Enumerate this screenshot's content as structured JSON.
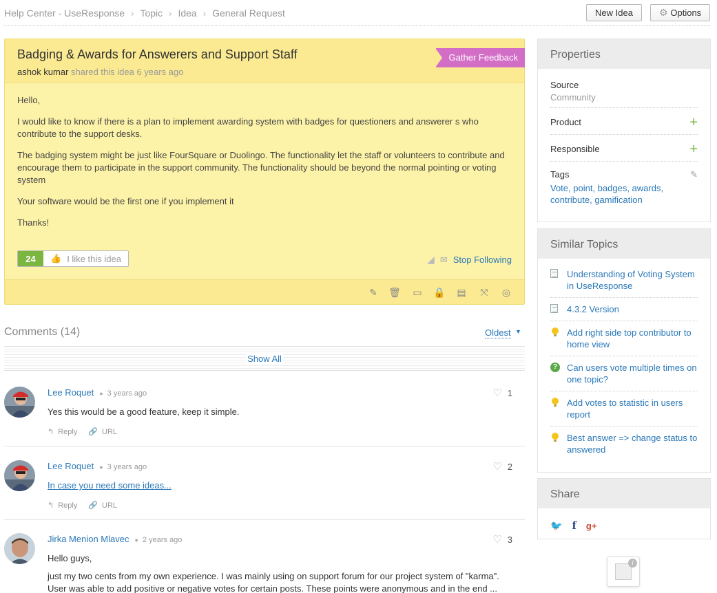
{
  "breadcrumbs": [
    "Help Center - UseResponse",
    "Topic",
    "Idea",
    "General Request"
  ],
  "toolbar": {
    "new_idea": "New Idea",
    "options": "Options"
  },
  "idea": {
    "title": "Badging & Awards for Answerers and Support Staff",
    "author": "ashok kumar",
    "meta": "shared this idea 6 years ago",
    "status": "Gather Feedback",
    "body": [
      "Hello,",
      "I would like to know if there is a plan to implement awarding system with badges for questioners and answerer s who contribute to the support desks.",
      "The badging system might be just like FourSquare or Duolingo. The functionality let the staff or volunteers to contribute and encourage them to participate in the support community. The functionality should be beyond the normal pointing or voting system",
      "Your software would be the first one if you implement it",
      "Thanks!"
    ],
    "vote_count": "24",
    "like_label": "I like this idea",
    "follow_label": "Stop Following",
    "tools": [
      "edit-icon",
      "delete-icon",
      "move-icon",
      "lock-icon",
      "card-icon",
      "merge-icon",
      "support-icon"
    ]
  },
  "comments": {
    "title": "Comments (14)",
    "sort": "Oldest",
    "show_all": "Show All",
    "reply_label": "Reply",
    "url_label": "URL",
    "items": [
      {
        "author": "Lee Roquet",
        "time": "3 years ago",
        "text": "Yes this would be a good feature, keep it simple.",
        "likes": "1"
      },
      {
        "author": "Lee Roquet",
        "time": "3 years ago",
        "text": "In case you need some ideas...",
        "likes": "2"
      },
      {
        "author": "Jirka Menion Mlavec",
        "time": "2 years ago",
        "text": "Hello guys,",
        "text2": "just my two cents from my own experience. I was mainly using on support forum for our project system of \"karma\". User was able to add positive or negative votes for certain posts. These points were anonymous and in the end ... after two",
        "likes": "3"
      }
    ]
  },
  "properties": {
    "title": "Properties",
    "source_label": "Source",
    "source_value": "Community",
    "product_label": "Product",
    "responsible_label": "Responsible",
    "tags_label": "Tags",
    "tags_line1": "Vote, point, badges, awards,",
    "tags_line2": "contribute, gamification"
  },
  "similar": {
    "title": "Similar Topics",
    "items": [
      {
        "icon": "document-icon",
        "line1": "Understanding of Voting System",
        "line2": "in UseResponse"
      },
      {
        "icon": "document-icon",
        "line1": "4.3.2 Version",
        "line2": ""
      },
      {
        "icon": "idea-bulb-icon",
        "line1": "Add right side top contributor to",
        "line2": "home view"
      },
      {
        "icon": "question-icon",
        "line1": "Can users vote multiple times on",
        "line2": "one topic?"
      },
      {
        "icon": "idea-bulb-icon",
        "line1": "Add votes to statistic in users",
        "line2": "report"
      },
      {
        "icon": "idea-bulb-icon",
        "line1": "Best answer => change status to",
        "line2": "answered"
      }
    ]
  },
  "share": {
    "title": "Share"
  },
  "colors": {
    "link": "#2a78b8",
    "vote_green": "#7ab640",
    "status_pink": "#d36ec6",
    "idea_bg": "#fdf3a8"
  }
}
